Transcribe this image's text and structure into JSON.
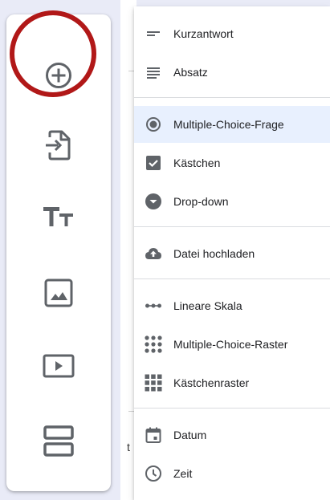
{
  "toolbar": {
    "tools": [
      {
        "name": "add-question-button",
        "icon": "add-circle-icon"
      },
      {
        "name": "import-questions-button",
        "icon": "import-file-icon"
      },
      {
        "name": "add-title-button",
        "icon": "title-text-icon"
      },
      {
        "name": "add-image-button",
        "icon": "image-icon"
      },
      {
        "name": "add-video-button",
        "icon": "video-icon"
      },
      {
        "name": "add-section-button",
        "icon": "section-icon"
      }
    ],
    "highlight_color": "#b11818"
  },
  "menu": {
    "items": [
      {
        "label": "Kurzantwort",
        "icon": "short-text-icon"
      },
      {
        "label": "Absatz",
        "icon": "paragraph-icon"
      },
      {
        "label": "Multiple-Choice-Frage",
        "icon": "radio-button-icon",
        "selected": true
      },
      {
        "label": "Kästchen",
        "icon": "checkbox-icon"
      },
      {
        "label": "Drop-down",
        "icon": "dropdown-icon"
      },
      {
        "label": "Datei hochladen",
        "icon": "cloud-upload-icon"
      },
      {
        "label": "Lineare Skala",
        "icon": "linear-scale-icon"
      },
      {
        "label": "Multiple-Choice-Raster",
        "icon": "dot-grid-icon"
      },
      {
        "label": "Kästchenraster",
        "icon": "checkbox-grid-icon"
      },
      {
        "label": "Datum",
        "icon": "calendar-icon"
      },
      {
        "label": "Zeit",
        "icon": "clock-icon"
      }
    ],
    "selected_color": "#e8f0fe"
  },
  "background": {
    "partial_text": "t"
  }
}
